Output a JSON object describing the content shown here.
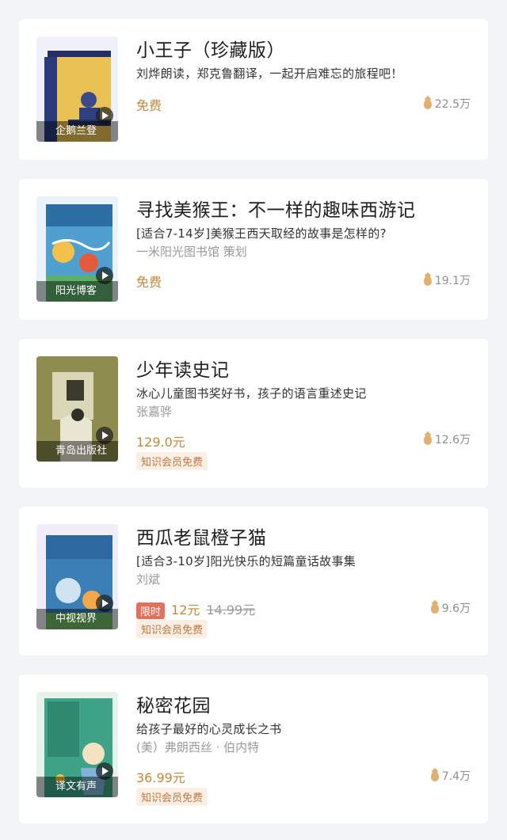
{
  "items": [
    {
      "title": "小王子（珍藏版）",
      "description": "刘烨朗读，郑克鲁翻译，一起开启难忘的旅程吧！",
      "author": "",
      "price": "免费",
      "plays": "22.5万",
      "publisher": "企鹅兰登",
      "cover_color": "#2a3b7a"
    },
    {
      "title": "寻找美猴王：不一样的趣味西游记",
      "description": "[适合7-14岁]美猴王西天取经的故事是怎样的?",
      "author": "一米阳光图书馆 策划",
      "price": "免费",
      "plays": "19.1万",
      "publisher": "阳光博客",
      "cover_color": "#3f8fc0"
    },
    {
      "title": "少年读史记",
      "description": "冰心儿童图书奖好书，孩子的语言重述史记",
      "author": "张嘉骅",
      "price": "129.0元",
      "plays": "12.6万",
      "publisher": "青岛出版社",
      "badge": "知识会员免费",
      "cover_color": "#8a8a4a"
    },
    {
      "title": "西瓜老鼠橙子猫",
      "description": "[适合3-10岁]阳光快乐的短篇童话故事集",
      "author": "刘斌",
      "limited": "限时",
      "price": "12元",
      "original_price": "14.99元",
      "plays": "9.6万",
      "publisher": "中视视界",
      "badge": "知识会员免费",
      "cover_color": "#3a7fb5"
    },
    {
      "title": "秘密花园",
      "description": "给孩子最好的心灵成长之书",
      "author": "(美）弗朗西丝 · 伯内特",
      "price": "36.99元",
      "plays": "7.4万",
      "publisher": "译文有声",
      "badge": "知识会员免费",
      "cover_color": "#3fa487"
    }
  ]
}
